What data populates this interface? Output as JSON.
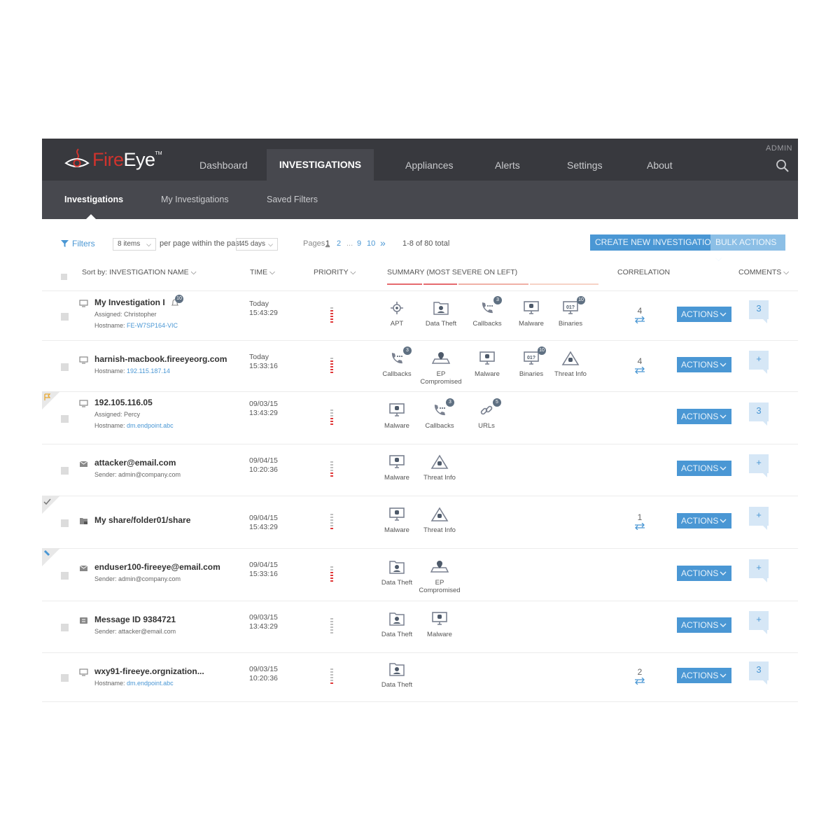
{
  "nav": {
    "logo_fire": "Fire",
    "logo_eye": "Eye",
    "logo_tm": "TM",
    "items": [
      "Dashboard",
      "INVESTIGATIONS",
      "Appliances",
      "Alerts",
      "Settings",
      "About"
    ],
    "admin_label": "ADMIN"
  },
  "subnav": {
    "items": [
      "Investigations",
      "My Investigations",
      "Saved Filters"
    ]
  },
  "toolbar": {
    "filters_label": "Filters",
    "items_select": "8 items",
    "per_page_text": "per page within the past",
    "days_select": "45 days",
    "pages_label": "Pages",
    "pages": [
      "1",
      "2",
      "...",
      "9",
      "10"
    ],
    "next_icon": "»",
    "total_text": "1-8 of 80 total",
    "create_label": "CREATE NEW INVESTIGATION",
    "bulk_label": "BULK ACTIONS"
  },
  "columns": {
    "sort": "Sort by: INVESTIGATION NAME",
    "time": "TIME",
    "priority": "PRIORITY",
    "summary": "SUMMARY (MOST SEVERE ON LEFT)",
    "correlation": "CORRELATION",
    "comments": "COMMENTS"
  },
  "actions_label": "ACTIONS",
  "rows": [
    {
      "name": "My Investigation I",
      "assigned": "Assigned: Christopher",
      "host_label": "Hostname: ",
      "host_value": "FE-W7SP164-VIC",
      "time1": "Today",
      "time2": "15:43:29",
      "name_badge": "10",
      "correlation": "4",
      "comment": "3",
      "summary": [
        {
          "label": "APT",
          "icon": "apt-icon"
        },
        {
          "label": "Data Theft",
          "icon": "data-theft-icon"
        },
        {
          "label": "Callbacks",
          "icon": "callbacks-icon",
          "badge": "3"
        },
        {
          "label": "Malware",
          "icon": "malware-icon"
        },
        {
          "label": "Binaries",
          "icon": "binaries-icon",
          "badge": "10"
        }
      ]
    },
    {
      "name": "harnish-macbook.fireeyeorg.com",
      "host_label": "Hostname: ",
      "host_value": "192.115.187.14",
      "time1": "Today",
      "time2": "15:33:16",
      "correlation": "4",
      "comment": "+",
      "summary": [
        {
          "label": "Callbacks",
          "icon": "callbacks-icon",
          "badge": "3"
        },
        {
          "label": "EP Compromised",
          "icon": "ep-compromised-icon"
        },
        {
          "label": "Malware",
          "icon": "malware-icon"
        },
        {
          "label": "Binaries",
          "icon": "binaries-icon",
          "badge": "10"
        },
        {
          "label": "Threat Info",
          "icon": "threat-info-icon"
        }
      ]
    },
    {
      "name": "192.105.116.05",
      "assigned": "Assigned: Percy",
      "host_label": "Hostname: ",
      "host_value": "dm.endpoint.abc",
      "time1": "09/03/15",
      "time2": "13:43:29",
      "comment": "3",
      "summary": [
        {
          "label": "Malware",
          "icon": "malware-icon"
        },
        {
          "label": "Callbacks",
          "icon": "callbacks-icon",
          "badge": "3"
        },
        {
          "label": "URLs",
          "icon": "urls-icon",
          "badge": "5"
        }
      ]
    },
    {
      "name": "attacker@email.com",
      "sender": "Sender: admin@company.com",
      "time1": "09/04/15",
      "time2": "10:20:36",
      "comment": "+",
      "summary": [
        {
          "label": "Malware",
          "icon": "malware-icon"
        },
        {
          "label": "Threat Info",
          "icon": "threat-info-icon"
        }
      ]
    },
    {
      "name": "My share/folder01/share",
      "time1": "09/04/15",
      "time2": "15:43:29",
      "correlation": "1",
      "comment": "+",
      "summary": [
        {
          "label": "Malware",
          "icon": "malware-icon"
        },
        {
          "label": "Threat Info",
          "icon": "threat-info-icon"
        }
      ]
    },
    {
      "name": "enduser100-fireeye@email.com",
      "sender": "Sender: admin@company.com",
      "time1": "09/04/15",
      "time2": "15:33:16",
      "comment": "+",
      "summary": [
        {
          "label": "Data Theft",
          "icon": "data-theft-icon"
        },
        {
          "label": "EP Compromised",
          "icon": "ep-compromised-icon"
        }
      ]
    },
    {
      "name": "Message ID 9384721",
      "sender": "Sender: attacker@email.com",
      "time1": "09/03/15",
      "time2": "13:43:29",
      "comment": "+",
      "summary": [
        {
          "label": "Data Theft",
          "icon": "data-theft-icon"
        },
        {
          "label": "Malware",
          "icon": "malware-icon"
        }
      ]
    },
    {
      "name": "wxy91-fireeye.orgnization...",
      "host_label": "Hostname: ",
      "host_value": "dm.endpoint.abc",
      "time1": "09/03/15",
      "time2": "10:20:36",
      "correlation": "2",
      "comment": "3",
      "summary": [
        {
          "label": "Data Theft",
          "icon": "data-theft-icon"
        }
      ]
    }
  ],
  "colors": {
    "accent": "#4a97d4",
    "nav_bg": "#38393e",
    "subnav_bg": "#47484e",
    "priority_high": "#e0393a",
    "priority_low": "#bfbfbf"
  }
}
